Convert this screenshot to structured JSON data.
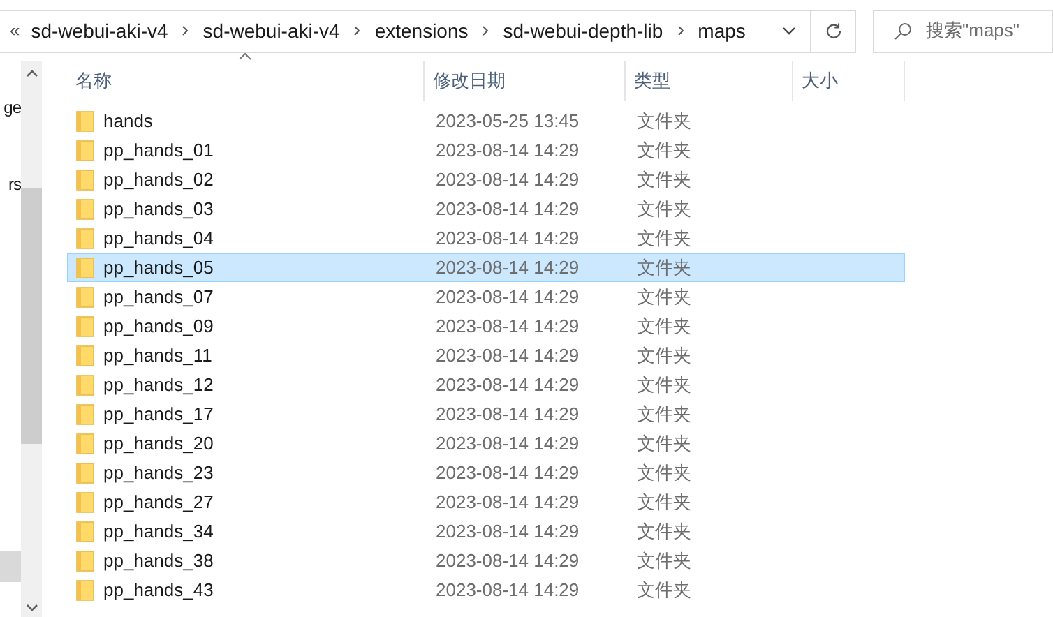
{
  "address_bar": {
    "overflow": "«",
    "segments": [
      "sd-webui-aki-v4",
      "sd-webui-aki-v4",
      "extensions",
      "sd-webui-depth-lib",
      "maps"
    ]
  },
  "search": {
    "placeholder": "搜索\"maps\""
  },
  "nav_pane": {
    "items": [
      {
        "label": "ge",
        "selected": false
      },
      {
        "label": "rs",
        "selected": false
      },
      {
        "selected": true
      }
    ]
  },
  "columns": [
    "名称",
    "修改日期",
    "类型",
    "大小"
  ],
  "rows": [
    {
      "name": "hands",
      "modified": "2023-05-25 13:45",
      "type": "文件夹",
      "selected": false
    },
    {
      "name": "pp_hands_01",
      "modified": "2023-08-14 14:29",
      "type": "文件夹",
      "selected": false
    },
    {
      "name": "pp_hands_02",
      "modified": "2023-08-14 14:29",
      "type": "文件夹",
      "selected": false
    },
    {
      "name": "pp_hands_03",
      "modified": "2023-08-14 14:29",
      "type": "文件夹",
      "selected": false
    },
    {
      "name": "pp_hands_04",
      "modified": "2023-08-14 14:29",
      "type": "文件夹",
      "selected": false
    },
    {
      "name": "pp_hands_05",
      "modified": "2023-08-14 14:29",
      "type": "文件夹",
      "selected": true
    },
    {
      "name": "pp_hands_07",
      "modified": "2023-08-14 14:29",
      "type": "文件夹",
      "selected": false
    },
    {
      "name": "pp_hands_09",
      "modified": "2023-08-14 14:29",
      "type": "文件夹",
      "selected": false
    },
    {
      "name": "pp_hands_11",
      "modified": "2023-08-14 14:29",
      "type": "文件夹",
      "selected": false
    },
    {
      "name": "pp_hands_12",
      "modified": "2023-08-14 14:29",
      "type": "文件夹",
      "selected": false
    },
    {
      "name": "pp_hands_17",
      "modified": "2023-08-14 14:29",
      "type": "文件夹",
      "selected": false
    },
    {
      "name": "pp_hands_20",
      "modified": "2023-08-14 14:29",
      "type": "文件夹",
      "selected": false
    },
    {
      "name": "pp_hands_23",
      "modified": "2023-08-14 14:29",
      "type": "文件夹",
      "selected": false
    },
    {
      "name": "pp_hands_27",
      "modified": "2023-08-14 14:29",
      "type": "文件夹",
      "selected": false
    },
    {
      "name": "pp_hands_34",
      "modified": "2023-08-14 14:29",
      "type": "文件夹",
      "selected": false
    },
    {
      "name": "pp_hands_38",
      "modified": "2023-08-14 14:29",
      "type": "文件夹",
      "selected": false
    },
    {
      "name": "pp_hands_43",
      "modified": "2023-08-14 14:29",
      "type": "文件夹",
      "selected": false
    }
  ]
}
